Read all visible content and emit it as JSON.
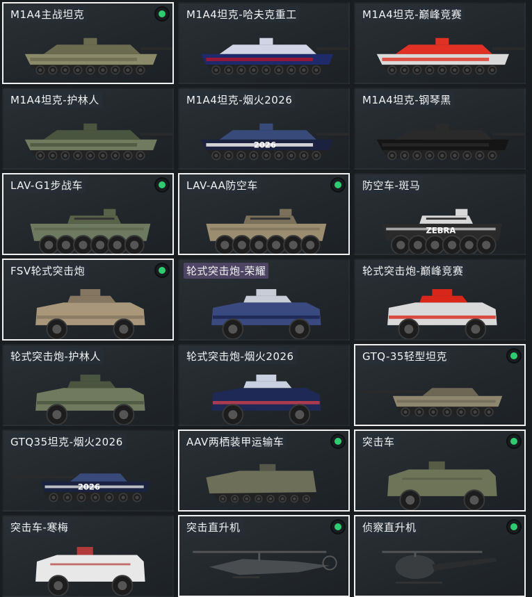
{
  "cards": [
    {
      "label": "M1A4主战坦克",
      "owned": true,
      "selected": true,
      "kind": "tank",
      "base": "#8a8a6a",
      "accent": "#6b6b50",
      "stripe": null
    },
    {
      "label": "M1A4坦克-哈夫克重工",
      "owned": false,
      "selected": false,
      "kind": "tank",
      "base": "#1f2a6b",
      "accent": "#d0d4e4",
      "stripe": "#b7132a"
    },
    {
      "label": "M1A4坦克-巅峰竞赛",
      "owned": false,
      "selected": false,
      "kind": "tank",
      "base": "#d9d9d9",
      "accent": "#e03124",
      "stripe": "#e03124"
    },
    {
      "label": "M1A4坦克-护林人",
      "owned": false,
      "selected": false,
      "kind": "tank",
      "base": "#6f7a5e",
      "accent": "#4a5540",
      "stripe": null
    },
    {
      "label": "M1A4坦克-烟火2026",
      "owned": false,
      "selected": false,
      "kind": "tank",
      "base": "#1a2240",
      "accent": "#384a7a",
      "stripe": "#ffffff",
      "text": "2026"
    },
    {
      "label": "M1A4坦克-钢琴黑",
      "owned": false,
      "selected": false,
      "kind": "tank",
      "base": "#151515",
      "accent": "#2a2a2a",
      "stripe": null
    },
    {
      "label": "LAV-G1步战车",
      "owned": true,
      "selected": true,
      "kind": "apc",
      "base": "#6e7a60",
      "accent": "#586248",
      "stripe": null
    },
    {
      "label": "LAV-AA防空车",
      "owned": true,
      "selected": true,
      "kind": "apc",
      "base": "#9a8d70",
      "accent": "#7b705a",
      "stripe": null
    },
    {
      "label": "防空车-斑马",
      "owned": false,
      "selected": false,
      "kind": "apc",
      "base": "#2a2a2a",
      "accent": "#d8d8d8",
      "stripe": "#d8d8d8",
      "text": "ZEBRA"
    },
    {
      "label": "FSV轮式突击炮",
      "owned": true,
      "selected": true,
      "kind": "truck",
      "base": "#a8977a",
      "accent": "#847660",
      "stripe": null
    },
    {
      "label": "轮式突击炮-荣耀",
      "owned": false,
      "selected": false,
      "kind": "truck",
      "base": "#3a4a80",
      "accent": "#c8ccd6",
      "stripe": "#1b2450",
      "hl": true
    },
    {
      "label": "轮式突击炮-巅峰竞赛",
      "owned": false,
      "selected": false,
      "kind": "truck",
      "base": "#d9d9d9",
      "accent": "#d8261a",
      "stripe": "#d8261a"
    },
    {
      "label": "轮式突击炮-护林人",
      "owned": false,
      "selected": false,
      "kind": "truck",
      "base": "#6f7a5e",
      "accent": "#4a5540",
      "stripe": null
    },
    {
      "label": "轮式突击炮-烟火2026",
      "owned": false,
      "selected": false,
      "kind": "truck",
      "base": "#1e2a55",
      "accent": "#c8d0e0",
      "stripe": "#d14050"
    },
    {
      "label": "GTQ-35轻型坦克",
      "owned": true,
      "selected": true,
      "kind": "ltank",
      "base": "#8f8670",
      "accent": "#6e6754",
      "stripe": null
    },
    {
      "label": "GTQ35坦克-烟火2026",
      "owned": false,
      "selected": false,
      "kind": "ltank",
      "base": "#1a2240",
      "accent": "#384a7a",
      "stripe": "#ffffff",
      "text": "2026"
    },
    {
      "label": "AAV两栖装甲运输车",
      "owned": true,
      "selected": true,
      "kind": "aav",
      "base": "#6d6f58",
      "accent": "#55574a",
      "stripe": null
    },
    {
      "label": "突击车",
      "owned": true,
      "selected": true,
      "kind": "mrap",
      "base": "#6e7458",
      "accent": "#575c45",
      "stripe": null
    },
    {
      "label": "突击车-寒梅",
      "owned": false,
      "selected": false,
      "kind": "mrap",
      "base": "#e8e8e8",
      "accent": "#b23a3a",
      "stripe": "#b23a3a"
    },
    {
      "label": "突击直升机",
      "owned": true,
      "selected": true,
      "kind": "heli",
      "base": "#4a4d50",
      "accent": "#333639",
      "stripe": null
    },
    {
      "label": "侦察直升机",
      "owned": true,
      "selected": true,
      "kind": "lheli",
      "base": "#3a3d40",
      "accent": "#2a2c2e",
      "stripe": null
    }
  ],
  "icons": {
    "owned": "owned-dot-icon"
  }
}
